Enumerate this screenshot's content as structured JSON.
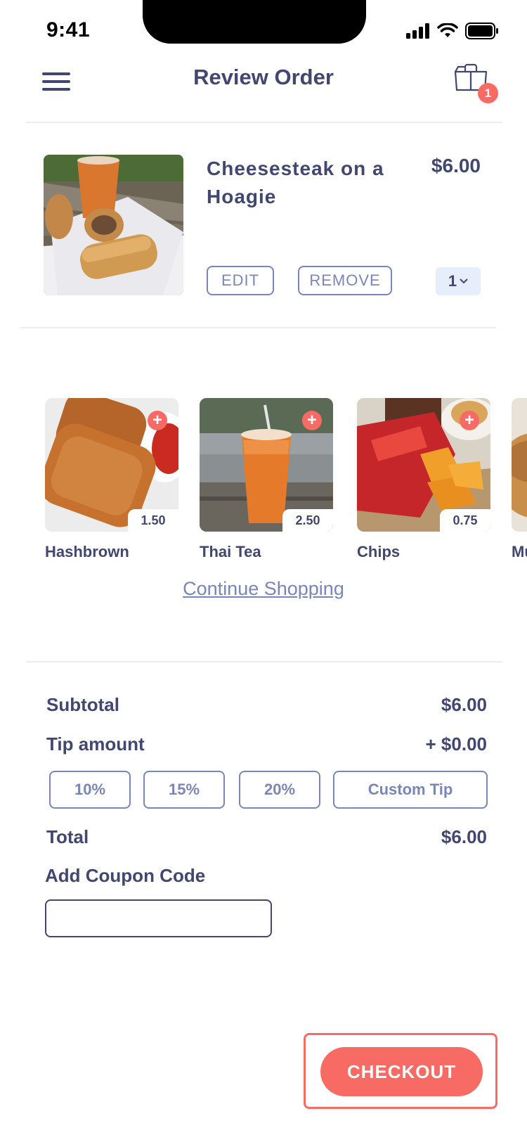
{
  "status_bar": {
    "time": "9:41"
  },
  "header": {
    "title": "Review Order",
    "cart_count": "1"
  },
  "order_item": {
    "name": "Cheesesteak on a Hoagie",
    "price": "$6.00",
    "edit_label": "EDIT",
    "remove_label": "REMOVE",
    "quantity": "1"
  },
  "upsell": {
    "items": [
      {
        "name": "Hashbrown",
        "price": "1.50"
      },
      {
        "name": "Thai Tea",
        "price": "2.50"
      },
      {
        "name": "Chips",
        "price": "0.75"
      },
      {
        "name": "Mu"
      }
    ]
  },
  "continue_link": "Continue Shopping",
  "summary": {
    "subtotal_label": "Subtotal",
    "subtotal_value": "$6.00",
    "tip_label": "Tip amount",
    "tip_value": "+ $0.00",
    "tip_options": [
      "10%",
      "15%",
      "20%",
      "Custom Tip"
    ],
    "total_label": "Total",
    "total_value": "$6.00"
  },
  "coupon": {
    "label": "Add Coupon Code",
    "value": ""
  },
  "checkout_label": "CHECKOUT",
  "colors": {
    "accent": "#f76b64",
    "primary_text": "#414770",
    "outline": "#7a86b8",
    "qty_bg": "#e6eefb"
  }
}
